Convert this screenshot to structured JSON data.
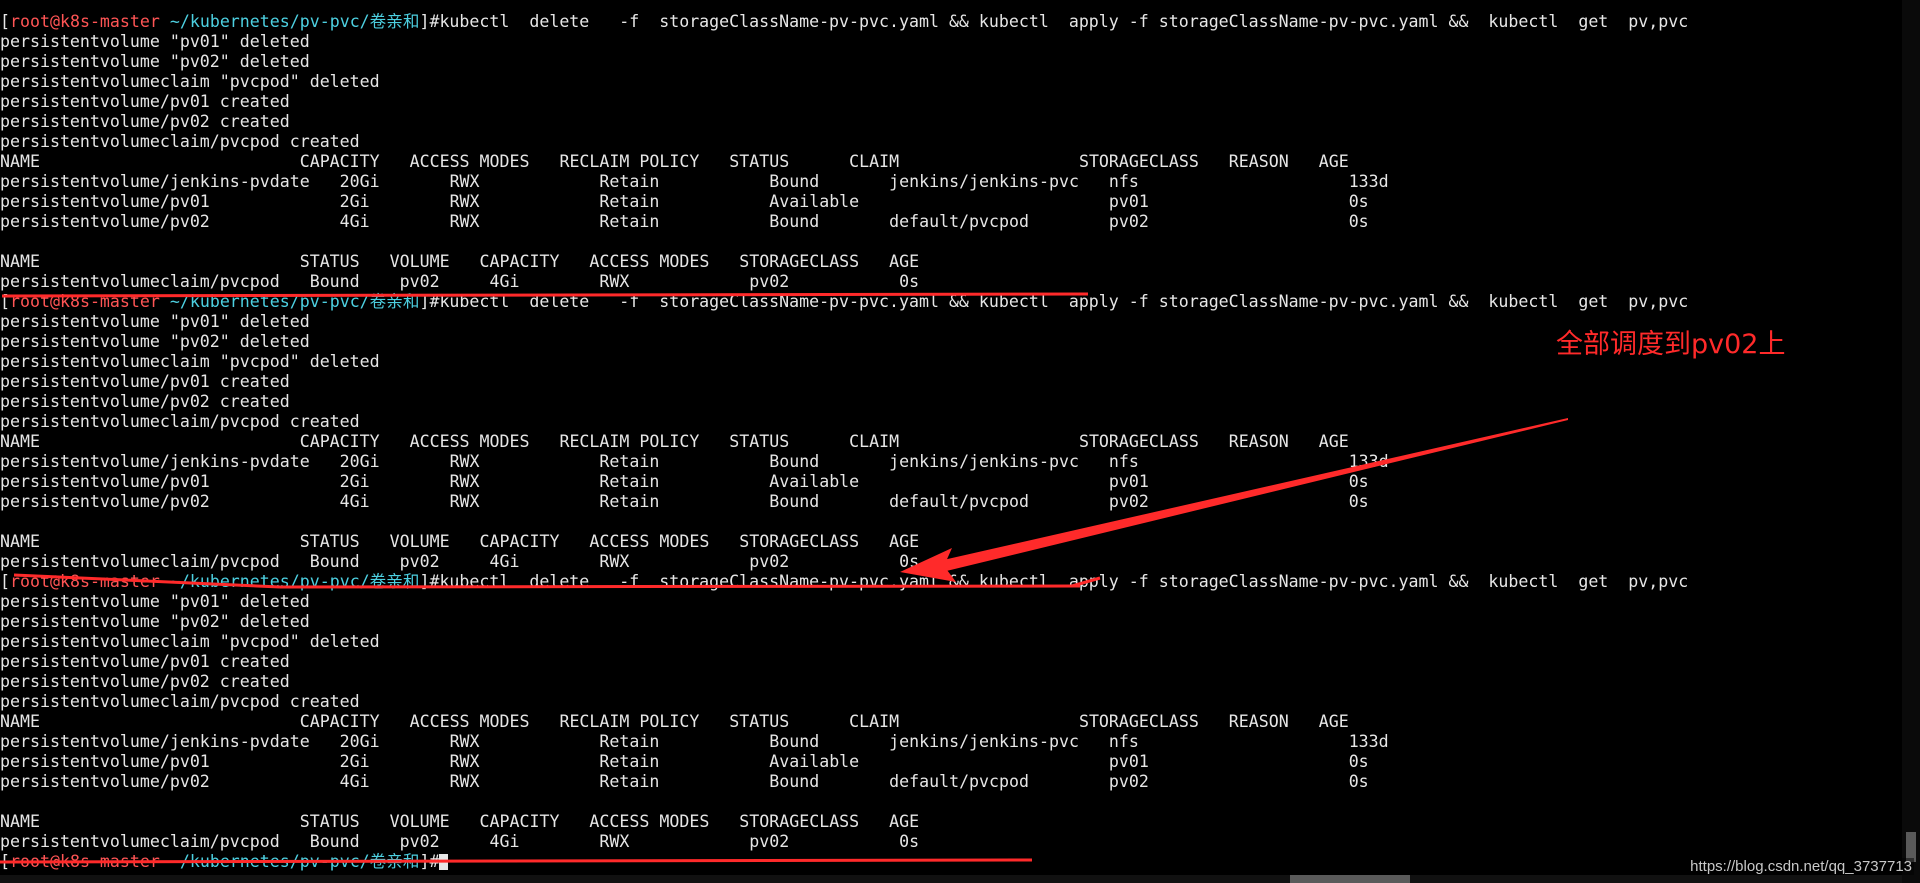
{
  "prompt": {
    "open_bracket": "[",
    "user": "root",
    "at": "@",
    "host": "k8s-master",
    "path": " ~/kubernetes/pv-pvc/卷亲和",
    "close": "]#"
  },
  "command": "kubectl  delete   -f  storageClassName-pv-pvc.yaml && kubectl  apply -f storageClassName-pv-pvc.yaml &&  kubectl  get  pv,pvc",
  "output_lines": [
    "persistentvolume \"pv01\" deleted",
    "persistentvolume \"pv02\" deleted",
    "persistentvolumeclaim \"pvcpod\" deleted",
    "persistentvolume/pv01 created",
    "persistentvolume/pv02 created",
    "persistentvolumeclaim/pvcpod created"
  ],
  "pv_table": {
    "header": "NAME                          CAPACITY   ACCESS MODES   RECLAIM POLICY   STATUS      CLAIM                  STORAGECLASS   REASON   AGE",
    "rows": [
      "persistentvolume/jenkins-pvdate   20Gi       RWX            Retain           Bound       jenkins/jenkins-pvc   nfs                     133d",
      "persistentvolume/pv01             2Gi        RWX            Retain           Available                         pv01                    0s",
      "persistentvolume/pv02             4Gi        RWX            Retain           Bound       default/pvcpod        pv02                    0s"
    ]
  },
  "pvc_table": {
    "header": "NAME                          STATUS   VOLUME   CAPACITY   ACCESS MODES   STORAGECLASS   AGE",
    "row": "persistentvolumeclaim/pvcpod   Bound    pv02     4Gi        RWX            pv02           0s"
  },
  "annotation": {
    "text": "全部调度到pv02上",
    "color": "#ff2a2a"
  },
  "watermark": "https://blog.csdn.net/qq_3737713",
  "colors": {
    "background": "#000000",
    "foreground": "#e6e6e6",
    "prompt_user_host": "#ff5555",
    "prompt_path": "#4dd0e1"
  }
}
